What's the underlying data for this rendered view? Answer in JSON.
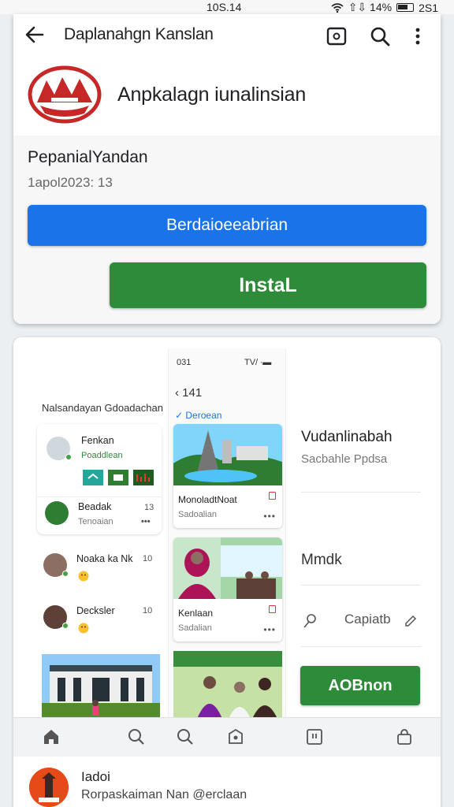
{
  "status": {
    "time": "10S.14",
    "signal": "⇧⇩ 14%",
    "battery": "2S1"
  },
  "appbar": {
    "title": "Daplanahgn Kanslan"
  },
  "app": {
    "name": "Anpkalagn iunalinsian",
    "publisher": "PepanialYandan",
    "date": "1apol2023: 13"
  },
  "buttons": {
    "primary": "Berdaioeeabrian",
    "install": "InstaL"
  },
  "screenshot": {
    "phone_time": "031",
    "phone_status": "TV/ ∙▬",
    "phone_back": "‹ 141",
    "phone_check": "✓ Deroean",
    "list_title": "Nalsandayan Gdoadachan",
    "left_items": [
      {
        "name": "Fenkan",
        "sub": "Poaddlean"
      },
      {
        "name": "Beadak",
        "sub": "Tenoaian",
        "num": "13"
      },
      {
        "name": "Noaka ka Nk",
        "num": "10"
      },
      {
        "name": "Decksler",
        "num": "10"
      }
    ],
    "tiles": [
      {
        "title": "MonoladtNoat",
        "sub": "Sadoalian"
      },
      {
        "title": "Kenlaan",
        "sub": "Sadalian"
      }
    ],
    "right_title": "Vudanlinabah",
    "right_sub": "Sacbahle Ppdsa",
    "right_text": "Mmdk",
    "right_apply": "Capiatb",
    "right_button": "AOBnon"
  },
  "footer": {
    "title": "Iadoi",
    "subtitle": "Rorpaskaiman Nan @erclaan"
  },
  "colors": {
    "blue": "#1a73e8",
    "green": "#2e8b3a",
    "red": "#d32f2f"
  }
}
